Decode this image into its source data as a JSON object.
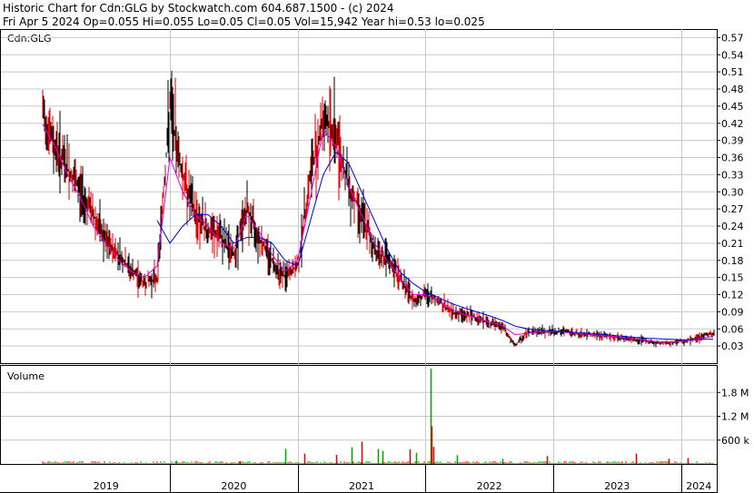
{
  "header": {
    "line1": "Historic Chart for Cdn:GLG by Stockwatch.com 604.687.1500 - (c) 2024",
    "line2": "Fri Apr  5 2024  Op=0.055  Hi=0.055  Lo=0.05  Cl=0.05  Vol=15,942  Year hi=0.53  lo=0.025"
  },
  "colors": {
    "ma_short": "#e000e0",
    "ma_long": "#0000d0",
    "up_tick": "#000000",
    "down_tick": "#e00000",
    "vol_up": "#00a000",
    "vol_down": "#e00000",
    "grid": "#c8c8c8",
    "axis": "#000000"
  },
  "chart_data": [
    {
      "type": "line",
      "title": "Cdn:GLG",
      "x": [
        2019.0,
        2019.1,
        2019.2,
        2019.3,
        2019.4,
        2019.5,
        2019.6,
        2019.7,
        2019.8,
        2019.9,
        2020.0,
        2020.1,
        2020.2,
        2020.3,
        2020.4,
        2020.5,
        2020.6,
        2020.7,
        2020.8,
        2020.9,
        2021.0,
        2021.1,
        2021.2,
        2021.3,
        2021.4,
        2021.5,
        2021.6,
        2021.7,
        2021.8,
        2021.9,
        2022.0,
        2022.1,
        2022.2,
        2022.3,
        2022.4,
        2022.5,
        2022.6,
        2022.7,
        2022.8,
        2022.9,
        2023.0,
        2023.1,
        2023.2,
        2023.3,
        2023.4,
        2023.5,
        2023.6,
        2023.7,
        2023.8,
        2023.9,
        2024.0,
        2024.1,
        2024.2,
        2024.26
      ],
      "series": [
        {
          "kind": "price",
          "values": [
            0.44,
            0.38,
            0.34,
            0.3,
            0.26,
            0.21,
            0.19,
            0.16,
            0.14,
            0.15,
            0.45,
            0.33,
            0.26,
            0.23,
            0.22,
            0.19,
            0.27,
            0.22,
            0.18,
            0.15,
            0.17,
            0.33,
            0.43,
            0.4,
            0.31,
            0.26,
            0.2,
            0.18,
            0.15,
            0.11,
            0.12,
            0.11,
            0.09,
            0.085,
            0.08,
            0.07,
            0.065,
            0.03,
            0.055,
            0.055,
            0.055,
            0.055,
            0.05,
            0.05,
            0.048,
            0.045,
            0.042,
            0.04,
            0.035,
            0.035,
            0.038,
            0.042,
            0.05,
            0.05
          ]
        },
        {
          "kind": "ma_short",
          "values": [
            0.42,
            0.38,
            0.33,
            0.29,
            0.24,
            0.21,
            0.18,
            0.16,
            0.15,
            0.17,
            0.36,
            0.3,
            0.26,
            0.24,
            0.21,
            0.2,
            0.26,
            0.23,
            0.19,
            0.16,
            0.18,
            0.29,
            0.41,
            0.38,
            0.31,
            0.26,
            0.21,
            0.18,
            0.15,
            0.12,
            0.12,
            0.11,
            0.095,
            0.085,
            0.08,
            0.072,
            0.066,
            0.05,
            0.052,
            0.055,
            0.055,
            0.055,
            0.052,
            0.05,
            0.048,
            0.046,
            0.043,
            0.041,
            0.038,
            0.037,
            0.038,
            0.041,
            0.045,
            0.047
          ]
        },
        {
          "kind": "ma_long",
          "values": [
            null,
            null,
            null,
            null,
            null,
            null,
            null,
            null,
            null,
            0.25,
            0.21,
            0.24,
            0.26,
            0.26,
            0.24,
            0.21,
            0.22,
            0.22,
            0.21,
            0.18,
            0.17,
            0.25,
            0.33,
            0.37,
            0.35,
            0.3,
            0.25,
            0.2,
            0.16,
            0.14,
            0.125,
            0.115,
            0.105,
            0.097,
            0.09,
            0.083,
            0.075,
            0.065,
            0.06,
            0.058,
            0.056,
            0.055,
            0.053,
            0.052,
            0.05,
            0.048,
            0.046,
            0.044,
            0.043,
            0.042,
            0.041,
            0.041,
            0.042,
            0.042
          ]
        }
      ],
      "y_ticks": [
        "0.57",
        "0.54",
        "0.51",
        "0.48",
        "0.45",
        "0.42",
        "0.39",
        "0.36",
        "0.33",
        "0.30",
        "0.27",
        "0.24",
        "0.21",
        "0.18",
        "0.15",
        "0.12",
        "0.09",
        "0.06",
        "0.03"
      ],
      "ylim": [
        0.0,
        0.585
      ],
      "grid": true
    },
    {
      "type": "bar",
      "title": "Volume",
      "y_ticks": [
        "1.8 M",
        "1.2 M",
        "600 k"
      ],
      "y_tick_values": [
        1800000,
        1200000,
        600000
      ],
      "ylim": [
        0,
        2400000
      ],
      "x_ticks": [
        "2019",
        "2020",
        "2021",
        "2022",
        "2023",
        "2024"
      ],
      "spikes": [
        {
          "x": 2020.05,
          "value": 80000,
          "up": true
        },
        {
          "x": 2020.55,
          "value": 60000,
          "up": false
        },
        {
          "x": 2020.9,
          "value": 380000,
          "up": true
        },
        {
          "x": 2021.05,
          "value": 260000,
          "up": false
        },
        {
          "x": 2021.3,
          "value": 230000,
          "up": false
        },
        {
          "x": 2021.42,
          "value": 420000,
          "up": true
        },
        {
          "x": 2021.5,
          "value": 560000,
          "up": false
        },
        {
          "x": 2021.63,
          "value": 380000,
          "up": true
        },
        {
          "x": 2021.66,
          "value": 330000,
          "up": true
        },
        {
          "x": 2021.88,
          "value": 370000,
          "up": false
        },
        {
          "x": 2021.93,
          "value": 280000,
          "up": true
        },
        {
          "x": 2022.04,
          "value": 2400000,
          "up": true
        },
        {
          "x": 2022.05,
          "value": 950000,
          "up": false
        },
        {
          "x": 2022.06,
          "value": 430000,
          "up": false
        },
        {
          "x": 2022.25,
          "value": 220000,
          "up": true
        },
        {
          "x": 2022.6,
          "value": 130000,
          "up": true
        },
        {
          "x": 2022.95,
          "value": 200000,
          "up": false
        },
        {
          "x": 2023.65,
          "value": 260000,
          "up": false
        },
        {
          "x": 2023.9,
          "value": 130000,
          "up": false
        },
        {
          "x": 2024.05,
          "value": 150000,
          "up": false
        }
      ]
    }
  ]
}
